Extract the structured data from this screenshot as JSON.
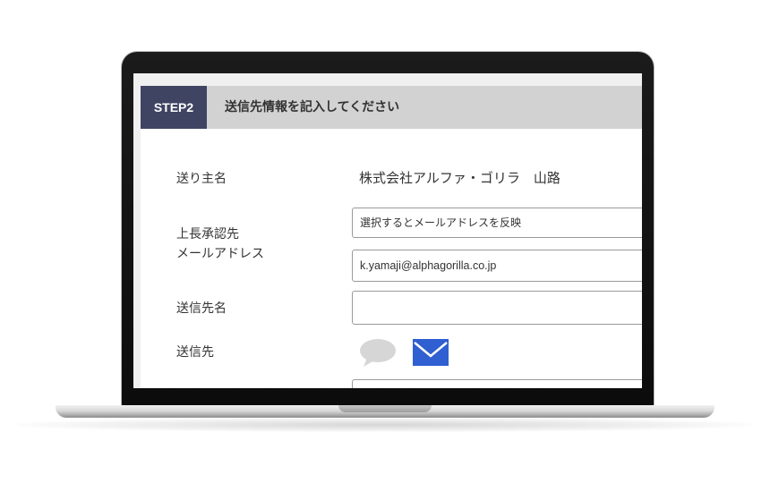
{
  "form": {
    "step_badge": "STEP2",
    "step_title": "送信先情報を記入してください",
    "sender": {
      "label": "送り主名",
      "value": "株式会社アルファ・ゴリラ　山路"
    },
    "approver": {
      "label_line1": "上長承認先",
      "label_line2": "メールアドレス",
      "select_value": "選択するとメールアドレスを反映",
      "email_value": "k.yamaji@alphagorilla.co.jp"
    },
    "recipient_name": {
      "label": "送信先名",
      "value": ""
    },
    "recipient": {
      "label": "送信先",
      "icons": [
        "speech-bubble-icon",
        "mail-icon"
      ]
    }
  },
  "colors": {
    "badge_bg": "#3f4463",
    "header_bg": "#d2d2d2",
    "mail_icon": "#2f5fd0",
    "bubble_icon": "#d6d6d6"
  }
}
